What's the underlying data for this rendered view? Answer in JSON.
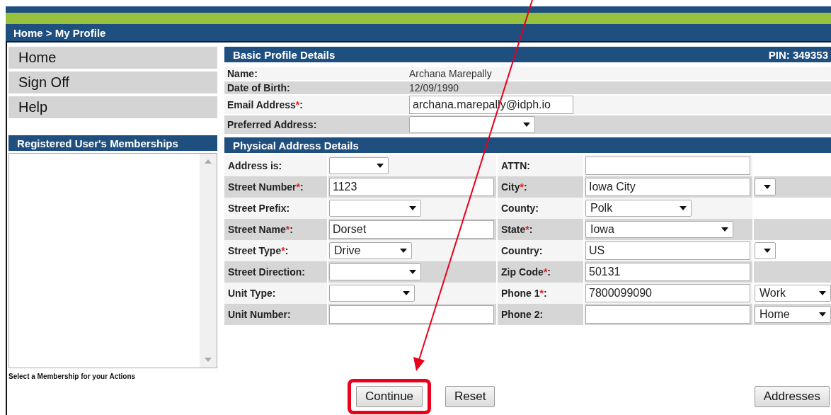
{
  "breadcrumb": "Home > My Profile",
  "nav": [
    {
      "label": "Home"
    },
    {
      "label": "Sign Off"
    },
    {
      "label": "Help"
    }
  ],
  "memberships": {
    "title": "Registered User's Memberships",
    "caption": "Select a Membership for your Actions"
  },
  "basic_profile": {
    "title": "Basic Profile Details",
    "pin": "PIN: 349353",
    "rows": [
      {
        "label": "Name:",
        "kind": "text",
        "value": "Archana Marepally"
      },
      {
        "label": "Date of Birth:",
        "kind": "text",
        "value": "12/09/1990"
      },
      {
        "label": "Email Address",
        "req": "*",
        "end": ":",
        "kind": "input",
        "value": "archana.marepally@idph.io"
      },
      {
        "label": "Preferred Address:",
        "kind": "select"
      }
    ]
  },
  "physical_address": {
    "title": "Physical Address Details",
    "rows": [
      {
        "left": {
          "label": "Address is:",
          "kind": "select"
        },
        "right": {
          "label": "ATTN:",
          "kind": "input"
        }
      },
      {
        "left": {
          "label": "Street Number",
          "req": "*",
          "end": ":",
          "kind": "input",
          "value": "1123"
        },
        "right": {
          "label": "City",
          "req": "*",
          "end": ":",
          "kind": "input",
          "value": "Iowa City",
          "extra": {
            "kind": "select"
          }
        }
      },
      {
        "left": {
          "label": "Street Prefix:",
          "kind": "select"
        },
        "right": {
          "label": "County:",
          "kind": "select",
          "value": "Polk"
        }
      },
      {
        "left": {
          "label": "Street Name",
          "req": "*",
          "end": ":",
          "kind": "input",
          "value": "Dorset"
        },
        "right": {
          "label": "State",
          "req": "*",
          "end": ":",
          "kind": "select",
          "value": "Iowa"
        }
      },
      {
        "left": {
          "label": "Street Type",
          "req": "*",
          "end": ":",
          "kind": "select",
          "value": "Drive"
        },
        "right": {
          "label": "Country:",
          "kind": "input",
          "value": "US",
          "extra": {
            "kind": "select"
          }
        }
      },
      {
        "left": {
          "label": "Street Direction:",
          "kind": "select"
        },
        "right": {
          "label": "Zip Code",
          "req": "*",
          "end": ":",
          "kind": "input",
          "value": "50131"
        }
      },
      {
        "left": {
          "label": "Unit Type:",
          "kind": "select"
        },
        "right": {
          "label": "Phone 1",
          "req": "*",
          "end": ":",
          "kind": "input",
          "value": "7800099090",
          "extra": {
            "kind": "select",
            "value": "Work"
          }
        }
      },
      {
        "left": {
          "label": "Unit Number:",
          "kind": "input"
        },
        "right": {
          "label": "Phone 2:",
          "kind": "input",
          "extra": {
            "kind": "select",
            "value": "Home"
          }
        }
      }
    ]
  },
  "buttons": [
    {
      "label": "Continue",
      "highlighted": true
    },
    {
      "label": "Reset",
      "highlighted": false
    },
    {
      "label": "Addresses",
      "highlighted": false
    }
  ]
}
